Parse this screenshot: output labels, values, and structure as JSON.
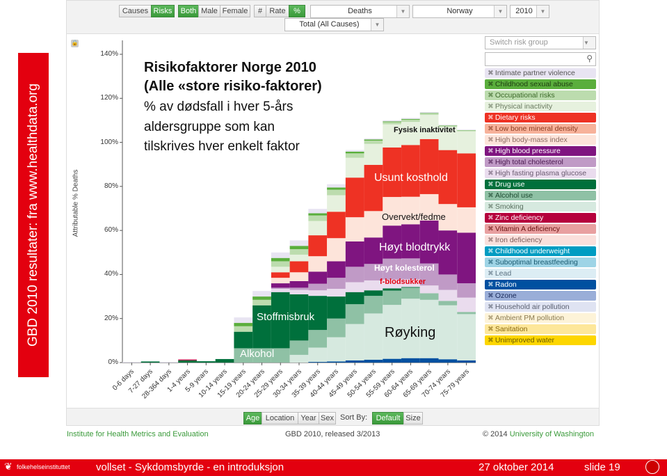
{
  "side_banner": "GBD 2010 resultater: fra www.healthdata.org",
  "toolbar": {
    "mode_buttons": [
      {
        "label": "Causes",
        "active": false
      },
      {
        "label": "Risks",
        "active": true
      }
    ],
    "sex_buttons": [
      {
        "label": "Both",
        "active": true
      },
      {
        "label": "Male",
        "active": false
      },
      {
        "label": "Female",
        "active": false
      }
    ],
    "metric_buttons": [
      {
        "label": "#",
        "active": false
      },
      {
        "label": "Rate",
        "active": false
      },
      {
        "label": "%",
        "active": true
      }
    ],
    "measure": "Deaths",
    "location": "Norway",
    "year": "2010",
    "cause": "Total (All Causes)"
  },
  "legend": {
    "switch_placeholder": "Switch risk group",
    "search_icon": "search-icon",
    "items": [
      {
        "label": "Intimate partner violence",
        "color": "#e8e4f2",
        "text": "#555"
      },
      {
        "label": "Childhood sexual abuse",
        "color": "#5aae3c",
        "text": "#1d3d10"
      },
      {
        "label": "Occupational risks",
        "color": "#bcdcae",
        "text": "#3d6a2a"
      },
      {
        "label": "Physical inactivity",
        "color": "#e6f1de",
        "text": "#6a7a60"
      },
      {
        "label": "Dietary risks",
        "color": "#ee3224",
        "text": "#fff"
      },
      {
        "label": "Low bone mineral density",
        "color": "#f7b29a",
        "text": "#8a3a20"
      },
      {
        "label": "High body-mass index",
        "color": "#fde4da",
        "text": "#8a6a60"
      },
      {
        "label": "High blood pressure",
        "color": "#7f1580",
        "text": "#fff"
      },
      {
        "label": "High total cholesterol",
        "color": "#c09ac6",
        "text": "#4a1a50"
      },
      {
        "label": "High fasting plasma glucose",
        "color": "#eadcee",
        "text": "#6a5a70"
      },
      {
        "label": "Drug use",
        "color": "#00703c",
        "text": "#fff"
      },
      {
        "label": "Alcohol use",
        "color": "#8fc1a5",
        "text": "#1d4a30"
      },
      {
        "label": "Smoking",
        "color": "#d6e9df",
        "text": "#5a7060"
      },
      {
        "label": "Zinc deficiency",
        "color": "#b5003c",
        "text": "#fff"
      },
      {
        "label": "Vitamin A deficiency",
        "color": "#e8a0a0",
        "text": "#6a1010"
      },
      {
        "label": "Iron deficiency",
        "color": "#fae0dc",
        "text": "#7a5a58"
      },
      {
        "label": "Childhood underweight",
        "color": "#009cc2",
        "text": "#fff"
      },
      {
        "label": "Suboptimal breastfeeding",
        "color": "#9ed4e6",
        "text": "#1a5a70"
      },
      {
        "label": "Lead",
        "color": "#dcedf4",
        "text": "#5a7080"
      },
      {
        "label": "Radon",
        "color": "#0050a0",
        "text": "#fff"
      },
      {
        "label": "Ozone",
        "color": "#9aaed8",
        "text": "#1a2a5a"
      },
      {
        "label": "Household air pollution",
        "color": "#dfe3f2",
        "text": "#5a6070"
      },
      {
        "label": "Ambient PM pollution",
        "color": "#fdf3d8",
        "text": "#8a7a50"
      },
      {
        "label": "Sanitation",
        "color": "#fde79a",
        "text": "#8a6a10"
      },
      {
        "label": "Unimproved water",
        "color": "#fdd600",
        "text": "#6a5a00"
      }
    ]
  },
  "annotations": {
    "title1": "Risikofaktorer Norge 2010",
    "title2": "(Alle «store risiko-faktorer)",
    "sub1": "% av dødsfall i hver 5-års",
    "sub2": "aldersgruppe som kan",
    "sub3": "tilskrives hver enkelt faktor",
    "phys": "Fysisk inaktivitet",
    "diet": "Usunt kosthold",
    "bmi": "Overvekt/fedme",
    "bp": "Høyt blodtrykk",
    "chol": "Høyt kolesterol",
    "gluc": "f-blodsukker",
    "drug": "Stoffmisbruk",
    "smoke": "Røyking",
    "alc": "Alkohol"
  },
  "chart_data": {
    "type": "bar",
    "stacked": true,
    "ylabel": "Attributable % Deaths",
    "ylim": [
      0,
      140
    ],
    "yticks": [
      "0%",
      "20%",
      "40%",
      "60%",
      "80%",
      "100%",
      "120%",
      "140%"
    ],
    "categories": [
      "0-6 days",
      "7-27 days",
      "28-364 days",
      "1-4 years",
      "5-9 years",
      "10-14 years",
      "15-19 years",
      "20-24 years",
      "25-29 years",
      "30-34 years",
      "35-39 years",
      "40-44 years",
      "45-49 years",
      "50-54 years",
      "55-59 years",
      "60-64 years",
      "65-69 years",
      "70-74 years",
      "75-79 years"
    ],
    "series": [
      {
        "name": "Radon",
        "color": "#0050a0",
        "values": [
          0,
          0,
          0,
          0,
          0,
          0,
          0,
          0,
          0,
          0,
          0.3,
          0.5,
          1,
          1.3,
          1.7,
          2,
          2,
          1.5,
          1
        ]
      },
      {
        "name": "Smoking",
        "color": "#d6e9df",
        "values": [
          0,
          0,
          0,
          0,
          0,
          0,
          0,
          0,
          0,
          3.5,
          6.5,
          11,
          16.5,
          21,
          24.5,
          27,
          26.5,
          24.5,
          21
        ]
      },
      {
        "name": "Alcohol use",
        "color": "#8fc1a5",
        "values": [
          0,
          0,
          0,
          0,
          0,
          0,
          6.5,
          6.5,
          6.5,
          6.5,
          8,
          8.5,
          9,
          8,
          6.5,
          5,
          3,
          2,
          1
        ]
      },
      {
        "name": "Drug use",
        "color": "#00703c",
        "values": [
          0,
          0.5,
          0,
          1,
          0.6,
          1.6,
          7.5,
          19.5,
          25.5,
          21,
          15.5,
          10,
          5.5,
          2.5,
          1,
          0.3,
          0,
          0,
          0
        ]
      },
      {
        "name": "Zinc deficiency",
        "color": "#b5003c",
        "values": [
          0,
          0,
          0,
          0.4,
          0,
          0,
          0,
          0,
          0,
          0,
          0,
          0,
          0,
          0,
          0,
          0,
          0,
          0,
          0
        ]
      },
      {
        "name": "High fasting plasma glucose",
        "color": "#eadcee",
        "values": [
          0,
          0,
          0,
          0,
          0,
          0,
          0,
          0,
          1.5,
          2,
          2.5,
          3.5,
          4.5,
          4.5,
          4,
          3.5,
          3.5,
          5,
          6.5
        ]
      },
      {
        "name": "High total cholesterol",
        "color": "#c09ac6",
        "values": [
          0,
          0,
          0,
          0,
          0,
          0,
          0,
          0,
          0.5,
          1,
          3,
          5,
          7,
          7.5,
          9.5,
          9.5,
          10,
          7,
          6.5
        ]
      },
      {
        "name": "High blood pressure",
        "color": "#7f1580",
        "values": [
          0,
          0,
          0,
          0,
          0,
          0,
          0,
          0,
          2,
          3,
          5.5,
          7.5,
          11.5,
          12,
          15,
          15.5,
          19.5,
          20,
          23
        ]
      },
      {
        "name": "High body-mass index",
        "color": "#fde4da",
        "values": [
          0,
          0,
          0,
          0,
          0,
          0,
          0,
          0,
          2.5,
          4,
          7,
          10.5,
          11,
          12,
          13,
          12.5,
          12,
          12,
          11.5
        ]
      },
      {
        "name": "Dietary risks",
        "color": "#ee3224",
        "values": [
          0,
          0,
          0,
          0,
          0,
          0,
          0,
          0,
          2.5,
          5,
          9.5,
          12,
          18,
          21,
          22.5,
          23.5,
          25,
          24.5,
          24.5
        ]
      },
      {
        "name": "Physical inactivity",
        "color": "#e6f1de",
        "values": [
          0,
          0,
          0,
          0,
          0,
          0,
          0,
          0,
          2.5,
          3,
          6.5,
          7.5,
          9,
          9.5,
          10.5,
          10.5,
          11,
          10.5,
          10
        ]
      },
      {
        "name": "Occupational risks",
        "color": "#bcdcae",
        "values": [
          0,
          0,
          0,
          0,
          0,
          0,
          2.5,
          2.5,
          2.5,
          2.5,
          2.5,
          2.5,
          2,
          1.5,
          1,
          1,
          0.6,
          0.5,
          0.3
        ]
      },
      {
        "name": "Childhood sexual abuse",
        "color": "#5aae3c",
        "values": [
          0,
          0,
          0,
          0,
          0,
          0,
          1.5,
          1.5,
          1.5,
          1.5,
          1,
          1,
          0.8,
          0.5,
          0.3,
          0.3,
          0.2,
          0.2,
          0.2
        ]
      },
      {
        "name": "Intimate partner violence",
        "color": "#e8e4f2",
        "values": [
          0.3,
          0,
          0.3,
          0,
          0,
          0,
          2.5,
          2.5,
          2.5,
          2.5,
          2,
          1.5,
          0.7,
          0.5,
          0.5,
          0.5,
          0.5,
          0.3,
          0.3
        ]
      }
    ]
  },
  "bottom_bar": {
    "group_buttons": [
      {
        "label": "Age",
        "active": true
      },
      {
        "label": "Location",
        "active": false
      },
      {
        "label": "Year",
        "active": false
      },
      {
        "label": "Sex",
        "active": false
      }
    ],
    "sort_label": "Sort By:",
    "sort_buttons": [
      {
        "label": "Default",
        "active": true
      },
      {
        "label": "Size",
        "active": false
      }
    ]
  },
  "credits": {
    "left": "Institute for Health Metrics and Evaluation",
    "center": "GBD 2010, released 3/2013",
    "right_prefix": "© 2014 ",
    "right_link": "University of Washington"
  },
  "footer": {
    "org": "folkehelseinstituttet",
    "text": "vollset  -  Sykdomsbyrde - en introduksjon",
    "date": "27 oktober  2014",
    "slide": "slide  19"
  }
}
